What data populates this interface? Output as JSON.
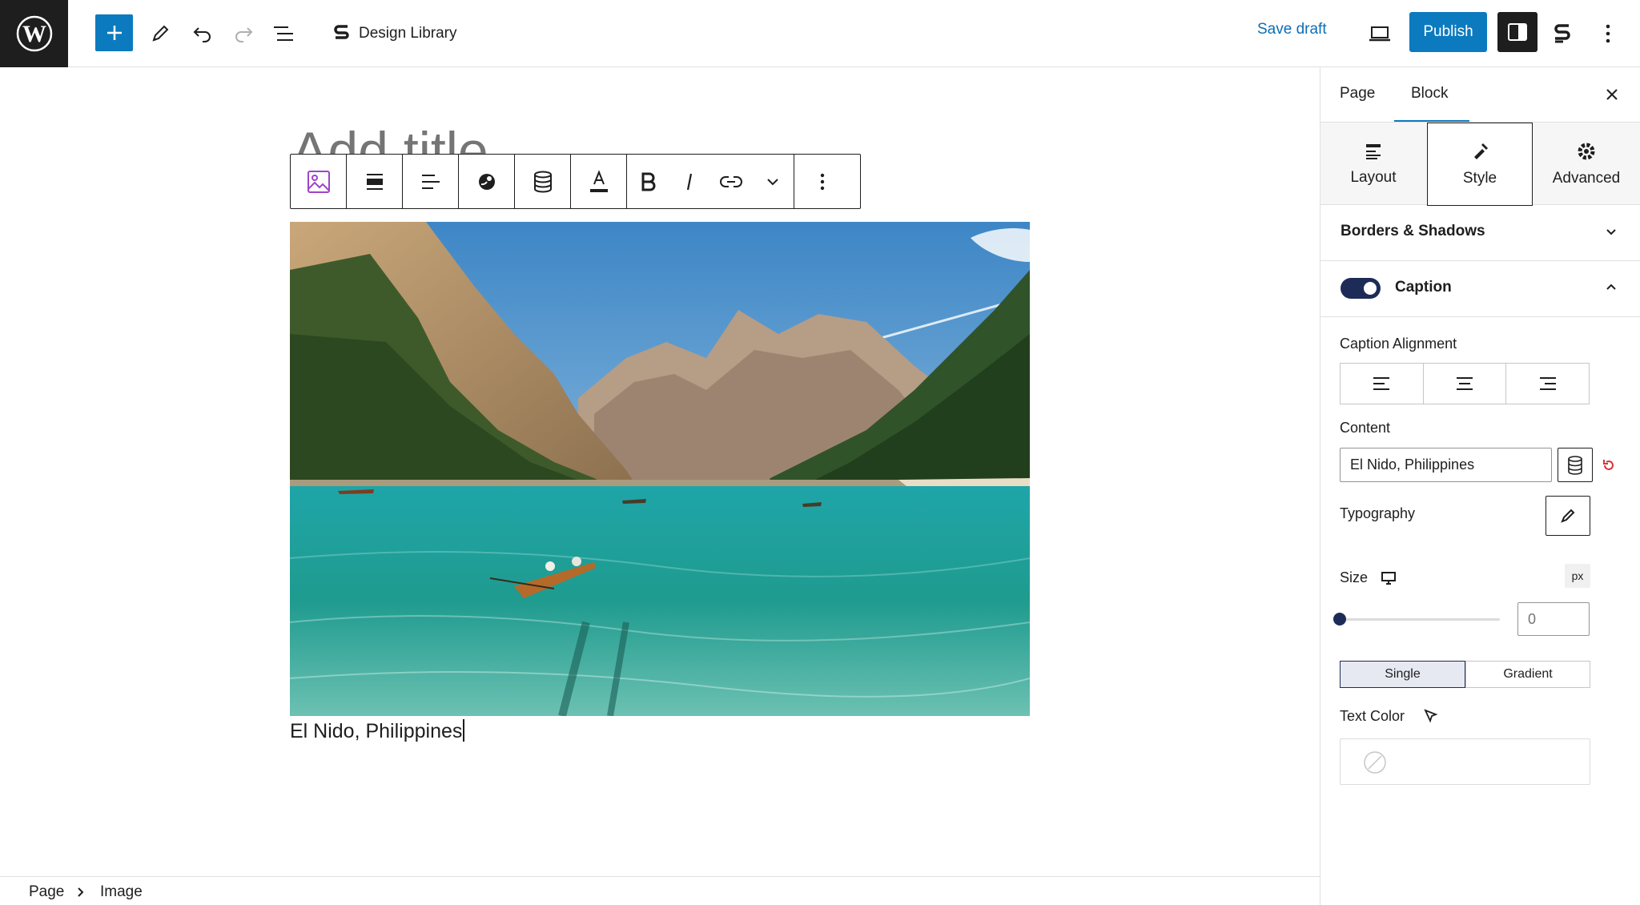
{
  "header": {
    "logo": "wordpress-logo",
    "document_title": "Design Library",
    "save_draft": "Save draft",
    "publish": "Publish"
  },
  "canvas": {
    "title_placeholder": "Add title",
    "caption": "El Nido, Philippines",
    "image_alt": "Mountain lake with turquoise water and a rowboat"
  },
  "sidebar": {
    "tabs": [
      {
        "label": "Page",
        "active": false
      },
      {
        "label": "Block",
        "active": true
      }
    ],
    "style_tabs": [
      {
        "label": "Layout",
        "icon": "layout-icon"
      },
      {
        "label": "Style",
        "icon": "brush-icon",
        "active": true
      },
      {
        "label": "Advanced",
        "icon": "gear-icon"
      }
    ],
    "panels": {
      "borders": "Borders & Shadows",
      "caption": "Caption",
      "caption_enabled": true
    },
    "caption_alignment_label": "Caption Alignment",
    "content_label": "Content",
    "content_value": "El Nido, Philippines",
    "typography_label": "Typography",
    "size_label": "Size",
    "size_unit": "px",
    "size_value": "0",
    "color_modes": [
      "Single",
      "Gradient"
    ],
    "color_mode_selected": "Single",
    "text_color_label": "Text Color"
  },
  "breadcrumb": [
    "Page",
    "Image"
  ],
  "colors": {
    "accent": "#0c7abf",
    "dark": "#1e1e1e",
    "toggle_on": "#1d2c57"
  }
}
